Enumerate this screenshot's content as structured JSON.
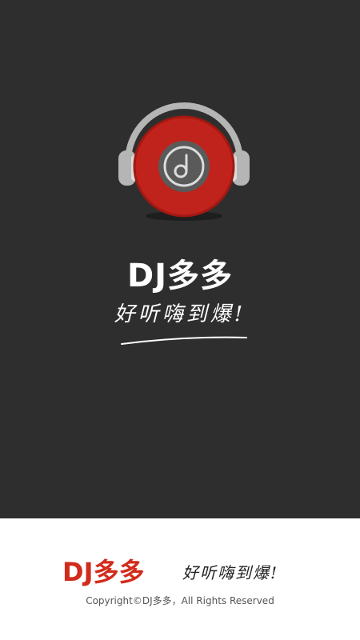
{
  "splash": {
    "icon": "headphones-music-disc-icon",
    "title": "DJ多多",
    "tagline": "好听嗨到爆!"
  },
  "footer": {
    "brand": "DJ多多",
    "tagline": "好听嗨到爆!",
    "copyright": "Copyright©DJ多多，All Rights Reserved"
  },
  "colors": {
    "background_dark": "#2e2e2e",
    "disc_red": "#c0231b",
    "brand_red": "#d22b1b",
    "headphone_gray": "#b5b5b5"
  }
}
